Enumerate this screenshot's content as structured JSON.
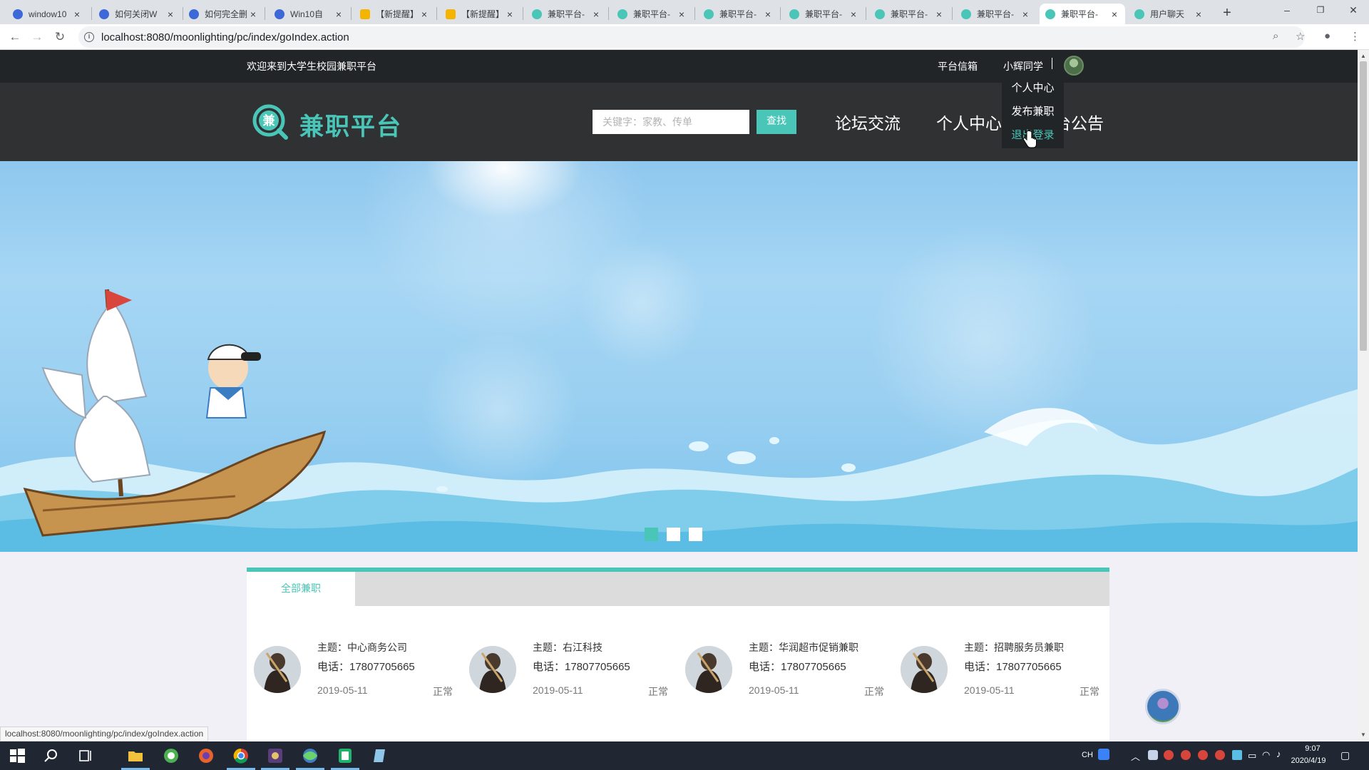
{
  "browser": {
    "tabs": [
      {
        "title": "window10",
        "icon_color": "#3d68d8",
        "active": false
      },
      {
        "title": "如何关闭W",
        "icon_color": "#3d68d8",
        "active": false
      },
      {
        "title": "如何完全删",
        "icon_color": "#3d68d8",
        "active": false
      },
      {
        "title": "Win10自",
        "icon_color": "#3d68d8",
        "active": false
      },
      {
        "title": "【新提醒】",
        "icon_color": "#f4b400",
        "active": false
      },
      {
        "title": "【新提醒】",
        "icon_color": "#f4b400",
        "active": false
      },
      {
        "title": "兼职平台-",
        "icon_color": "#49c6b8",
        "active": false
      },
      {
        "title": "兼职平台-",
        "icon_color": "#49c6b8",
        "active": false
      },
      {
        "title": "兼职平台-",
        "icon_color": "#49c6b8",
        "active": false
      },
      {
        "title": "兼职平台-",
        "icon_color": "#49c6b8",
        "active": false
      },
      {
        "title": "兼职平台-",
        "icon_color": "#49c6b8",
        "active": false
      },
      {
        "title": "兼职平台-",
        "icon_color": "#49c6b8",
        "active": false
      },
      {
        "title": "兼职平台-",
        "icon_color": "#49c6b8",
        "active": true
      },
      {
        "title": "用户聊天",
        "icon_color": "#49c6b8",
        "active": false
      }
    ],
    "url": "localhost:8080/moonlighting/pc/index/goIndex.action",
    "status_url": "localhost:8080/moonlighting/pc/index/goIndex.action"
  },
  "site": {
    "top": {
      "welcome": "欢迎来到大学生校园兼职平台",
      "mailbox": "平台信箱",
      "username": "小辉同学"
    },
    "header": {
      "logo_char": "兼",
      "logo_text": "兼职平台",
      "search_placeholder": "关键字：家教、传单",
      "search_button": "查找",
      "nav": {
        "forum": "论坛交流",
        "personal": "个人中心",
        "announcement": "平台公告"
      }
    },
    "dropdown": {
      "items": [
        "个人中心",
        "发布兼职",
        "退出登录"
      ],
      "hovered": "退出登录"
    },
    "banner": {
      "slide_count": 3,
      "active_slide": 1
    },
    "jobs": {
      "tab_label": "全部兼职",
      "cards": [
        {
          "topic": "主题：中心商务公司",
          "phone": "电话：17807705665",
          "date": "2019-05-11",
          "status": "正常"
        },
        {
          "topic": "主题：右江科技",
          "phone": "电话：17807705665",
          "date": "2019-05-11",
          "status": "正常"
        },
        {
          "topic": "主题：华润超市促销兼职",
          "phone": "电话：17807705665",
          "date": "2019-05-11",
          "status": "正常"
        },
        {
          "topic": "主题：招聘服务员兼职",
          "phone": "电话：17807705665",
          "date": "2019-05-11",
          "status": "正常"
        }
      ]
    },
    "colors": {
      "accent": "#49c6b8",
      "top_bar": "#222528",
      "header": "#2f3133"
    }
  },
  "taskbar": {
    "ime": "CH",
    "time": "9:07",
    "date": "2020/4/19"
  }
}
